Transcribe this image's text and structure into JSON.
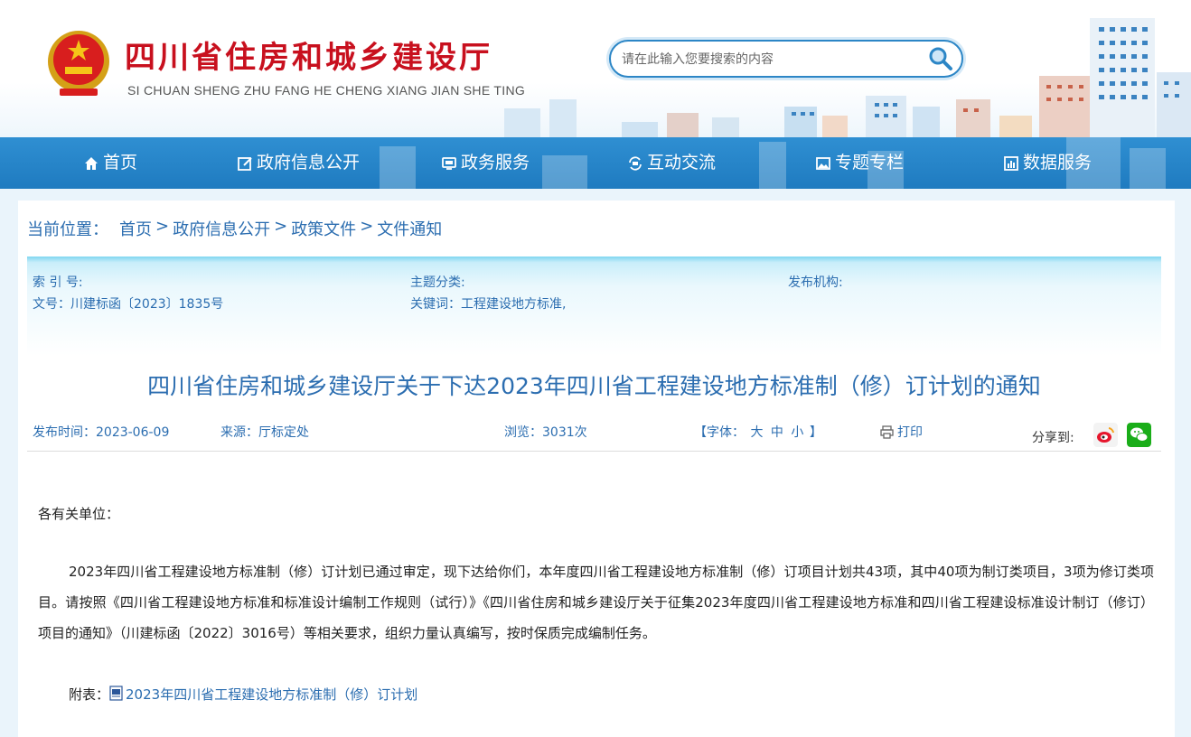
{
  "header": {
    "site_title": "四川省住房和城乡建设厅",
    "site_subtitle": "SI CHUAN SHENG ZHU FANG HE CHENG XIANG JIAN SHE TING",
    "search_placeholder": "请在此输入您要搜索的内容",
    "search_icon": "magnifier-icon",
    "emblem": "national-emblem"
  },
  "nav": {
    "items": [
      {
        "label": "首页",
        "icon": "home-icon"
      },
      {
        "label": "政府信息公开",
        "icon": "edit-icon"
      },
      {
        "label": "政务服务",
        "icon": "monitor-icon"
      },
      {
        "label": "互动交流",
        "icon": "exchange-icon"
      },
      {
        "label": "专题专栏",
        "icon": "image-icon"
      },
      {
        "label": "数据服务",
        "icon": "chart-icon"
      }
    ]
  },
  "breadcrumb": {
    "label": "当前位置：",
    "items": [
      "首页",
      "政府信息公开",
      "政策文件",
      "文件通知"
    ],
    "separator": ">"
  },
  "meta": {
    "index_no": "索 引 号:",
    "topic": "主题分类:",
    "publisher": "发布机构:",
    "doc_no": "文号：川建标函〔2023〕1835号",
    "keywords": "关键词：工程建设地方标准,"
  },
  "document": {
    "title": "四川省住房和城乡建设厅关于下达2023年四川省工程建设地方标准制（修）订计划的通知",
    "publish_time": "发布时间：2023-06-09",
    "source": "来源：厅标定处",
    "views": "浏览：3031次",
    "font_label_open": "【字体：",
    "font_large": "大",
    "font_medium": "中",
    "font_small": "小",
    "font_label_close": "】",
    "print": "打印",
    "share_label": "分享到:",
    "greeting": "各有关单位：",
    "paragraph": "2023年四川省工程建设地方标准制（修）订计划已通过审定，现下达给你们，本年度四川省工程建设地方标准制（修）订项目计划共43项，其中40项为制订类项目，3项为修订类项目。请按照《四川省工程建设地方标准和标准设计编制工作规则（试行）》《四川省住房和城乡建设厅关于征集2023年度四川省工程建设地方标准和四川省工程建设标准设计制订（修订）项目的通知》（川建标函〔2022〕3016号）等相关要求，组织力量认真编写，按时保质完成编制任务。",
    "attachment_label": "附表：",
    "attachment_link": "2023年四川省工程建设地方标准制（修）订计划"
  },
  "colors": {
    "brand_red": "#c8101e",
    "nav_blue": "#1f7bc0",
    "link_blue": "#2b6db0"
  }
}
